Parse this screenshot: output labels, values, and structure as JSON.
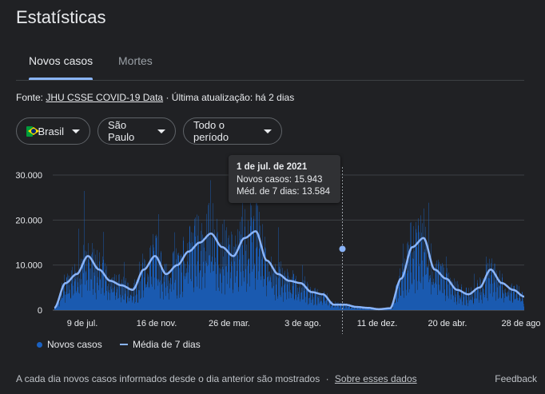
{
  "title": "Estatísticas",
  "tabs": [
    {
      "label": "Novos casos",
      "active": true
    },
    {
      "label": "Mortes",
      "active": false
    }
  ],
  "source": {
    "prefix": "Fonte:",
    "link": "JHU CSSE COVID-19 Data",
    "separator": "·",
    "updated": "Última atualização: há 2 dias"
  },
  "filters": {
    "country": "Brasil",
    "state": "São Paulo",
    "period": "Todo o período"
  },
  "tooltip": {
    "date": "1 de jul. de 2021",
    "cases": "Novos casos: 15.943",
    "avg": "Méd. de 7 dias: 13.584"
  },
  "legend": {
    "cases": "Novos casos",
    "avg": "Média de 7 dias"
  },
  "footer": {
    "note": "A cada dia novos casos informados desde o dia anterior são mostrados",
    "separator": "·",
    "link": "Sobre esses dados"
  },
  "feedback": "Feedback",
  "colors": {
    "bars": "#1a61c1",
    "avg_line": "#8ab4f8",
    "grid": "#3c4043",
    "background": "#202124"
  },
  "chart_data": {
    "type": "bar",
    "ylim": [
      0,
      30000
    ],
    "yticks": [
      "0",
      "10.000",
      "20.000",
      "30.000"
    ],
    "xticks": [
      "9 de jul.",
      "16 de nov.",
      "26 de mar.",
      "3 de ago.",
      "11 de dez.",
      "20 de abr.",
      "28 de ago"
    ],
    "series": [
      {
        "name": "Novos casos",
        "kind": "bar"
      },
      {
        "name": "Média de 7 dias",
        "kind": "line"
      }
    ],
    "avg_keypoints_weeks": [
      0,
      4,
      8,
      12,
      16,
      20,
      24,
      28,
      32,
      36,
      40,
      44,
      48,
      52,
      56,
      60,
      64,
      68,
      72,
      76,
      80,
      84,
      88,
      92,
      96,
      100,
      104,
      108,
      112,
      116,
      120,
      124,
      128,
      132,
      136,
      140,
      144,
      148,
      152,
      156,
      160,
      164,
      168
    ],
    "avg_keypoints_values": [
      500,
      6000,
      8000,
      12000,
      9000,
      6500,
      5500,
      4500,
      9000,
      12000,
      8000,
      10000,
      13000,
      15000,
      17000,
      14000,
      12000,
      16000,
      17500,
      11000,
      8000,
      6500,
      6000,
      4000,
      3500,
      1200,
      1200,
      700,
      500,
      200,
      400,
      7000,
      14000,
      16000,
      9000,
      7000,
      4500,
      3500,
      5000,
      9000,
      6000,
      4500,
      3000
    ],
    "highlight": {
      "x_week": 103,
      "cases": 15943,
      "avg": 13584
    }
  }
}
